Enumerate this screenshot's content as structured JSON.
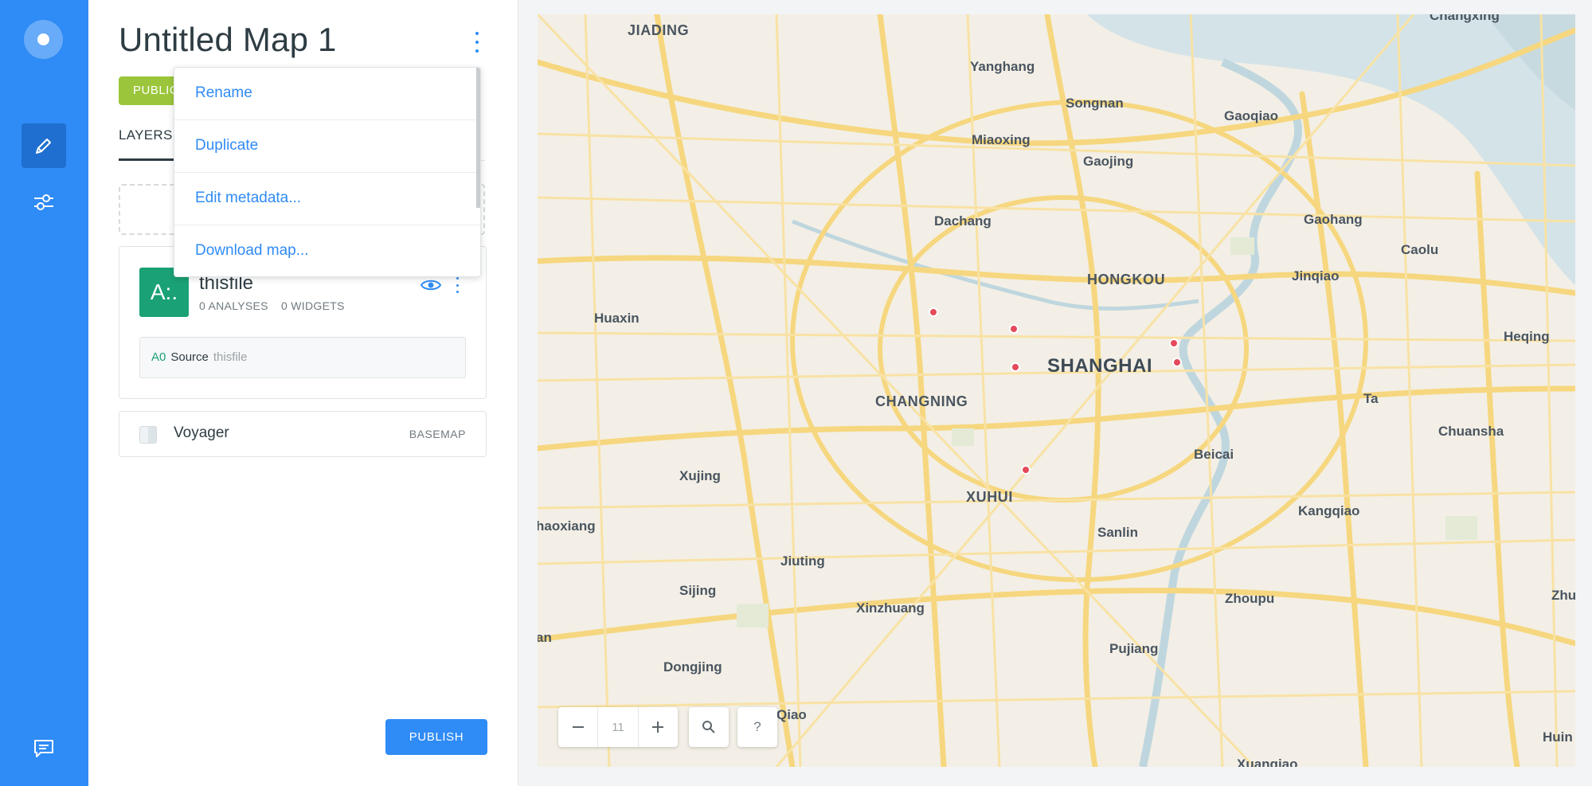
{
  "app": {
    "map_title": "Untitled Map 1",
    "privacy_badge": "PUBLIC",
    "publish_label": "PUBLISH"
  },
  "sidebar": {
    "tabs": [
      {
        "label": "LAYERS"
      }
    ]
  },
  "layer": {
    "avatar_text": "A:.",
    "name": "thisfile",
    "analyses": "0 ANALYSES",
    "widgets": "0 WIDGETS",
    "source": {
      "id": "A0",
      "label": "Source",
      "name": "thisfile"
    }
  },
  "basemap": {
    "name": "Voyager",
    "tag": "BASEMAP"
  },
  "context_menu": {
    "items": [
      {
        "label": "Rename"
      },
      {
        "label": "Duplicate"
      },
      {
        "label": "Edit metadata..."
      },
      {
        "label": "Download map..."
      }
    ]
  },
  "map": {
    "zoom": "11",
    "help_label": "?",
    "places": [
      {
        "name": "JIADING"
      },
      {
        "name": "Changxing"
      },
      {
        "name": "Yanghang"
      },
      {
        "name": "Songnan"
      },
      {
        "name": "Gaoqiao"
      },
      {
        "name": "Miaoxing"
      },
      {
        "name": "Gaojing"
      },
      {
        "name": "Dachang"
      },
      {
        "name": "Gaohang"
      },
      {
        "name": "Caolu"
      },
      {
        "name": "HONGKOU"
      },
      {
        "name": "Jinqiao"
      },
      {
        "name": "Huaxin"
      },
      {
        "name": "Heqing"
      },
      {
        "name": "SHANGHAI"
      },
      {
        "name": "CHANGNING"
      },
      {
        "name": "Ta"
      },
      {
        "name": "Chuansha"
      },
      {
        "name": "Beicai"
      },
      {
        "name": "Xujing"
      },
      {
        "name": "XUHUI"
      },
      {
        "name": "haoxiang"
      },
      {
        "name": "Kangqiao"
      },
      {
        "name": "Sanlin"
      },
      {
        "name": "Jiuting"
      },
      {
        "name": "Sijing"
      },
      {
        "name": "Zhoupu"
      },
      {
        "name": "Zhu"
      },
      {
        "name": "Xinzhuang"
      },
      {
        "name": "an"
      },
      {
        "name": "Pujiang"
      },
      {
        "name": "Dongjing"
      },
      {
        "name": "Qiao"
      },
      {
        "name": "Huin"
      },
      {
        "name": "Xuangiao"
      }
    ],
    "colors": {
      "land": "#f3efe6",
      "road": "#f6d77f",
      "water": "#d4e3e8",
      "marker": "#e44a5a"
    }
  }
}
